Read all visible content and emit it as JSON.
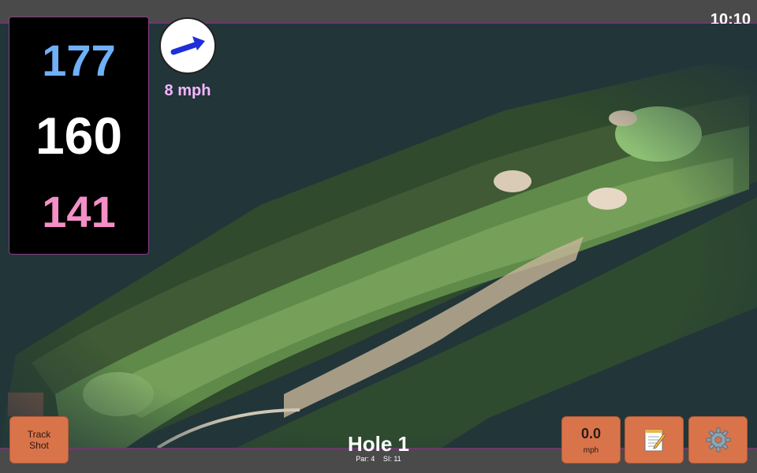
{
  "status_bar": {
    "time": "10:10"
  },
  "distances": {
    "back": "177",
    "middle": "160",
    "front": "141"
  },
  "wind": {
    "speed": "8 mph",
    "icon": "wind-direction-arrow-icon",
    "direction": "east-north-east"
  },
  "buttons": {
    "track_shot_line1": "Track",
    "track_shot_line2": "Shot",
    "speed_value": "0.0",
    "speed_unit": "mph",
    "notes_icon": "notepad-icon",
    "settings_icon": "gear-icon"
  },
  "hole": {
    "title": "Hole 1",
    "par": "Par: 4",
    "si": "SI: 11"
  },
  "colors": {
    "back_distance": "#6fb0f7",
    "middle_distance": "#ffffff",
    "front_distance": "#f48fc8",
    "button": "#d9744a",
    "wind_arrow": "#1f2fd8"
  }
}
